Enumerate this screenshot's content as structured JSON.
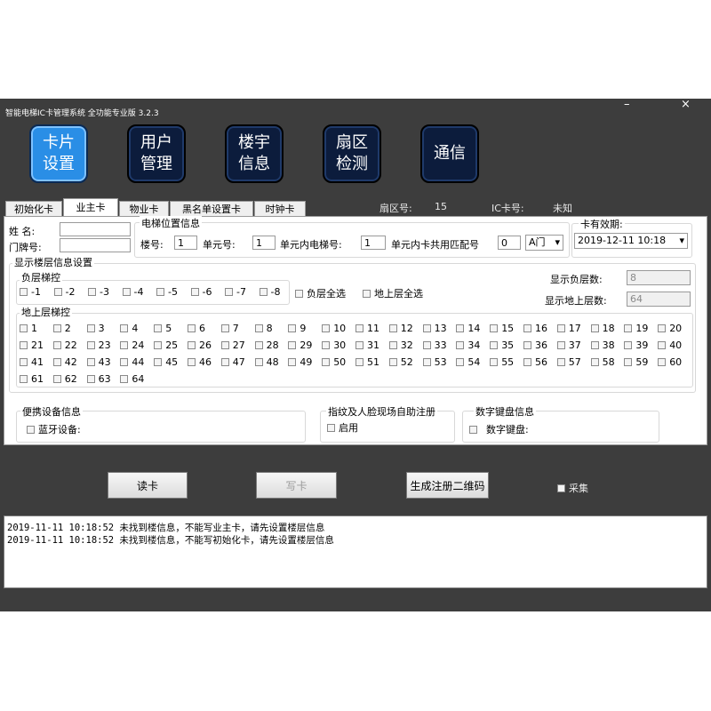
{
  "window": {
    "title": "智能电梯IC卡管理系统 全功能专业版 3.2.3",
    "minimize_glyph": "–",
    "close_glyph": "×"
  },
  "nav": [
    {
      "label_line1": "卡片",
      "label_line2": "设置",
      "active": true
    },
    {
      "label_line1": "用户",
      "label_line2": "管理",
      "active": false
    },
    {
      "label_line1": "楼宇",
      "label_line2": "信息",
      "active": false
    },
    {
      "label_line1": "扇区",
      "label_line2": "检测",
      "active": false
    },
    {
      "label_line1": "通信",
      "label_line2": "",
      "active": false
    }
  ],
  "tabs": [
    "初始化卡",
    "业主卡",
    "物业卡",
    "黑名单设置卡",
    "时钟卡"
  ],
  "active_tab": "业主卡",
  "tab_info": {
    "sector_label": "扇区号:",
    "sector_value": "15",
    "ic_label": "IC卡号:",
    "ic_value": "未知"
  },
  "owner": {
    "name_label": "姓  名:",
    "name_value": "",
    "door_label": "门牌号:",
    "door_value": ""
  },
  "elevator_info": {
    "title": "电梯位置信息",
    "building_label": "楼号:",
    "building_value": "1",
    "unit_label": "单元号:",
    "unit_value": "1",
    "elevator_label": "单元内电梯号:",
    "elevator_value": "1",
    "shared_label": "单元内卡共用匹配号",
    "shared_value": "0",
    "door_select": "A门"
  },
  "expiry": {
    "title": "卡有效期:",
    "value": "2019-12-11 10:18"
  },
  "floor_settings": {
    "title": "显示楼层信息设置",
    "negative_title": "负层梯控",
    "negative_floors": [
      "-1",
      "-2",
      "-3",
      "-4",
      "-5",
      "-6",
      "-7",
      "-8"
    ],
    "select_all_negative": "负层全选",
    "select_all_above": "地上层全选",
    "show_negative_label": "显示负层数:",
    "show_negative_value": "8",
    "show_above_label": "显示地上层数:",
    "show_above_value": "64",
    "above_title": "地上层梯控",
    "above_floors": [
      "1",
      "2",
      "3",
      "4",
      "5",
      "6",
      "7",
      "8",
      "9",
      "10",
      "11",
      "12",
      "13",
      "14",
      "15",
      "16",
      "17",
      "18",
      "19",
      "20",
      "21",
      "22",
      "23",
      "24",
      "25",
      "26",
      "27",
      "28",
      "29",
      "30",
      "31",
      "32",
      "33",
      "34",
      "35",
      "36",
      "37",
      "38",
      "39",
      "40",
      "41",
      "42",
      "43",
      "44",
      "45",
      "46",
      "47",
      "48",
      "49",
      "50",
      "51",
      "52",
      "53",
      "54",
      "55",
      "56",
      "57",
      "58",
      "59",
      "60",
      "61",
      "62",
      "63",
      "64"
    ]
  },
  "portable": {
    "title": "便携设备信息",
    "bluetooth_label": "蓝牙设备:"
  },
  "fingerprint": {
    "title": "指纹及人脸现场自助注册",
    "enable_label": "启用"
  },
  "keypad": {
    "title": "数字键盘信息",
    "keypad_label": "数字键盘:"
  },
  "actions": {
    "read": "读卡",
    "write": "写卡",
    "qrcode": "生成注册二维码",
    "collect": "采集"
  },
  "log": [
    "2019-11-11 10:18:52 未找到楼信息，不能写业主卡，请先设置楼层信息",
    "2019-11-11 10:18:52 未找到楼信息，不能写初始化卡，请先设置楼层信息"
  ],
  "colors": {
    "app_bg": "#3d3d3d",
    "active_nav": "#2a8ee6",
    "nav_bg": "#0c1c3c"
  }
}
